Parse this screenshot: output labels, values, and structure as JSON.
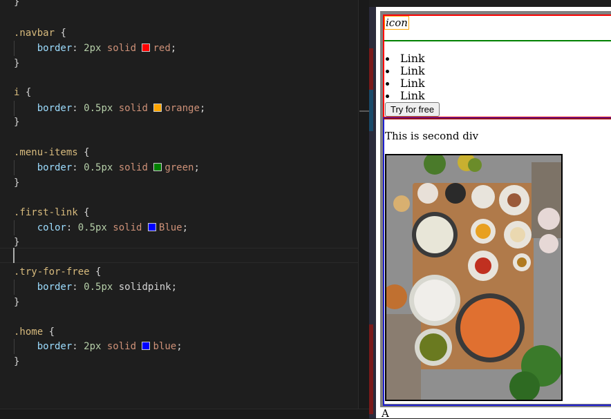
{
  "editor": {
    "lines": [
      {
        "parts": [
          {
            "t": "}",
            "c": "punc"
          }
        ]
      },
      {
        "parts": []
      },
      {
        "parts": [
          {
            "t": ".navbar",
            "c": "sel"
          },
          {
            "t": " {",
            "c": "punc"
          }
        ]
      },
      {
        "parts": [
          {
            "t": "    border",
            "c": "prop"
          },
          {
            "t": ": ",
            "c": "punc"
          },
          {
            "t": "2px",
            "c": "num"
          },
          {
            "t": " solid ",
            "c": "val"
          },
          {
            "swatch": "#ff0000"
          },
          {
            "t": "red",
            "c": "val"
          },
          {
            "t": ";",
            "c": "punc"
          }
        ]
      },
      {
        "parts": [
          {
            "t": "}",
            "c": "punc"
          }
        ]
      },
      {
        "parts": []
      },
      {
        "parts": [
          {
            "t": "i",
            "c": "sel"
          },
          {
            "t": " {",
            "c": "punc"
          }
        ]
      },
      {
        "parts": [
          {
            "t": "    border",
            "c": "prop"
          },
          {
            "t": ": ",
            "c": "punc"
          },
          {
            "t": "0.5px",
            "c": "num"
          },
          {
            "t": " solid ",
            "c": "val"
          },
          {
            "swatch": "#ffa500"
          },
          {
            "t": "orange",
            "c": "val"
          },
          {
            "t": ";",
            "c": "punc"
          }
        ]
      },
      {
        "parts": [
          {
            "t": "}",
            "c": "punc"
          }
        ]
      },
      {
        "parts": []
      },
      {
        "parts": [
          {
            "t": ".menu-items",
            "c": "sel"
          },
          {
            "t": " {",
            "c": "punc"
          }
        ]
      },
      {
        "parts": [
          {
            "t": "    border",
            "c": "prop"
          },
          {
            "t": ": ",
            "c": "punc"
          },
          {
            "t": "0.5px",
            "c": "num"
          },
          {
            "t": " solid ",
            "c": "val"
          },
          {
            "swatch": "#008000"
          },
          {
            "t": "green",
            "c": "val"
          },
          {
            "t": ";",
            "c": "punc"
          }
        ]
      },
      {
        "parts": [
          {
            "t": "}",
            "c": "punc"
          }
        ]
      },
      {
        "parts": []
      },
      {
        "parts": [
          {
            "t": ".first-link",
            "c": "sel"
          },
          {
            "t": " {",
            "c": "punc"
          }
        ]
      },
      {
        "parts": [
          {
            "t": "    color",
            "c": "prop"
          },
          {
            "t": ": ",
            "c": "punc"
          },
          {
            "t": "0.5px",
            "c": "num"
          },
          {
            "t": " solid ",
            "c": "val"
          },
          {
            "swatch": "#0000ff"
          },
          {
            "t": "Blue",
            "c": "val"
          },
          {
            "t": ";",
            "c": "punc"
          }
        ]
      },
      {
        "parts": [
          {
            "t": "}",
            "c": "punc"
          }
        ]
      },
      {
        "parts": []
      },
      {
        "parts": [
          {
            "t": ".try-for-free",
            "c": "sel"
          },
          {
            "t": " {",
            "c": "punc"
          }
        ]
      },
      {
        "parts": [
          {
            "t": "    border",
            "c": "prop"
          },
          {
            "t": ": ",
            "c": "punc"
          },
          {
            "t": "0.5px",
            "c": "num"
          },
          {
            "t": " solidpink",
            "c": "punc"
          },
          {
            "t": ";",
            "c": "punc"
          }
        ]
      },
      {
        "parts": [
          {
            "t": "}",
            "c": "punc"
          }
        ]
      },
      {
        "parts": []
      },
      {
        "parts": [
          {
            "t": ".home",
            "c": "sel"
          },
          {
            "t": " {",
            "c": "punc"
          }
        ]
      },
      {
        "parts": [
          {
            "t": "    border",
            "c": "prop"
          },
          {
            "t": ": ",
            "c": "punc"
          },
          {
            "t": "2px",
            "c": "num"
          },
          {
            "t": " solid ",
            "c": "val"
          },
          {
            "swatch": "#0000ff"
          },
          {
            "t": "blue",
            "c": "val"
          },
          {
            "t": ";",
            "c": "punc"
          }
        ]
      },
      {
        "parts": [
          {
            "t": "}",
            "c": "punc"
          }
        ]
      }
    ]
  },
  "preview": {
    "icon_text": "icon",
    "menu_items": [
      "Link",
      "Link",
      "Link",
      "Link"
    ],
    "button_label": "Try for free",
    "second_div_text": "This is second div",
    "image_alt": "food-ingredients-photo",
    "bottom_text": "A"
  }
}
